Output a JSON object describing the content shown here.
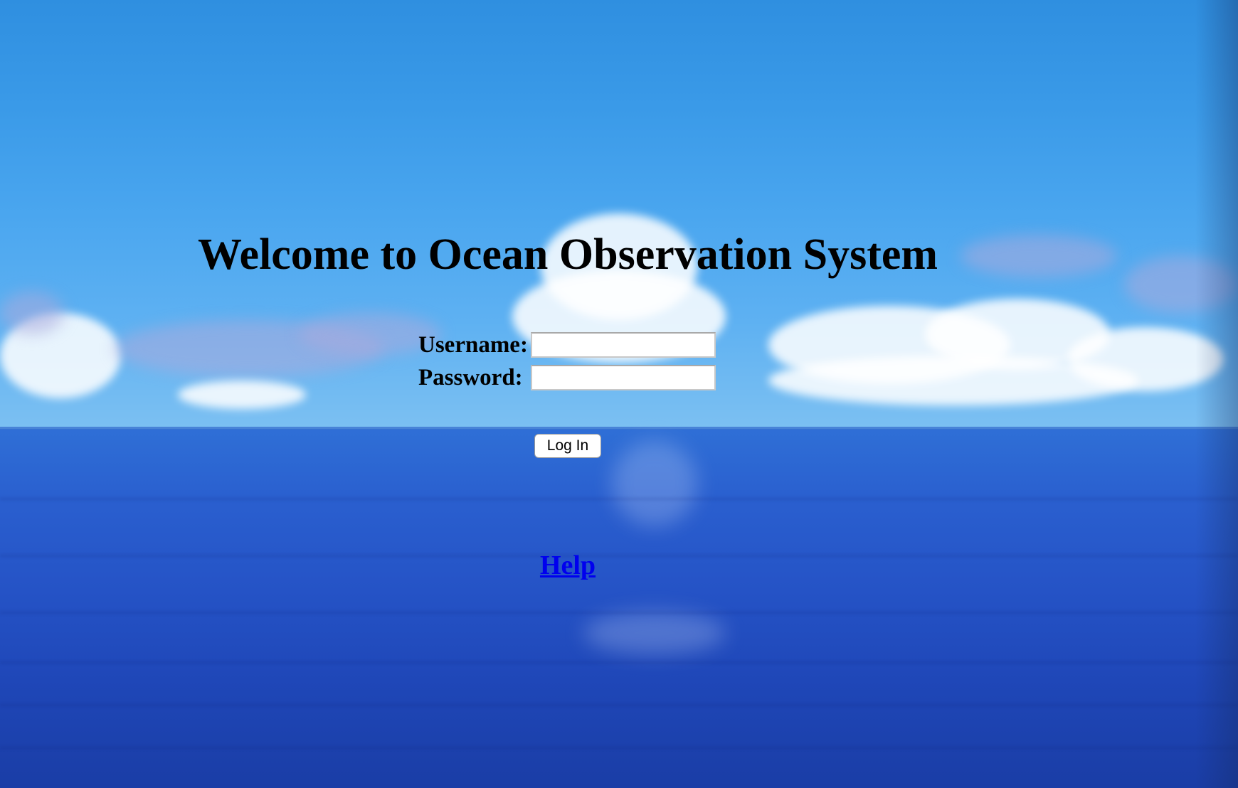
{
  "page": {
    "title": "Welcome to Ocean Observation System"
  },
  "login_form": {
    "username_label": "Username:",
    "username_value": "",
    "password_label": "Password:",
    "password_value": "",
    "submit_label": "Log In"
  },
  "links": {
    "help_label": "Help"
  },
  "colors": {
    "link": "#0000ee",
    "title_text": "#000000",
    "sky": "#3a9ae8",
    "sea": "#2553c6"
  },
  "background": {
    "scene": "ocean horizon with clouds"
  }
}
